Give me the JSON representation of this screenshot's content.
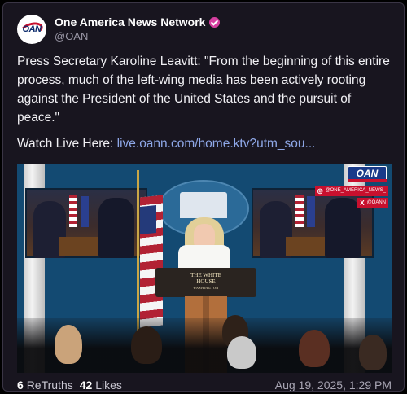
{
  "author": {
    "name": "One America News Network",
    "handle": "@OAN",
    "avatar_text": "OAN",
    "verified_color": "#d63fa0"
  },
  "post": {
    "text": "Press Secretary Karoline Leavitt: \"From the beginning of this entire process, much of the left-wing media has been actively rooting against the President of the United States and the pursuit of peace.\"",
    "watch_prefix": "Watch Live Here:",
    "link_text": "live.oann.com/home.ktv?utm_sou..."
  },
  "media": {
    "podium_sign": "THE WHITE HOUSE",
    "podium_sub": "WASHINGTON",
    "bug_logo": "OAN",
    "instagram_handle": "@ONE_AMERICA_NEWS_",
    "x_handle": "@OANN"
  },
  "footer": {
    "retruths_count": "6",
    "retruths_label": "ReTruths",
    "likes_count": "42",
    "likes_label": "Likes",
    "timestamp": "Aug 19, 2025, 1:29 PM"
  },
  "colors": {
    "background": "#18151f",
    "link": "#8fa8e8",
    "brand_red": "#c8102e",
    "brand_blue": "#1a3b8a"
  }
}
